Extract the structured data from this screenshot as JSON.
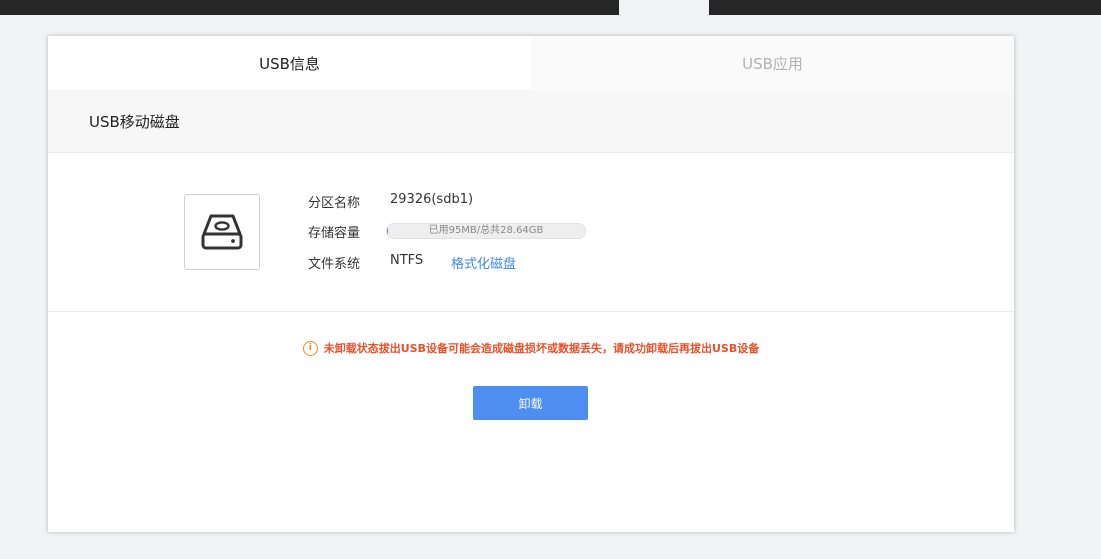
{
  "tabs": [
    {
      "label": "USB信息",
      "active": true
    },
    {
      "label": "USB应用",
      "active": false
    }
  ],
  "section": {
    "title": "USB移动磁盘"
  },
  "disk": {
    "icon": "hard-drive-icon",
    "partition_label": "分区名称",
    "partition_value": "29326(sdb1)",
    "capacity_label": "存储容量",
    "capacity_text": "已用95MB/总共28.64GB",
    "capacity_used_fraction": 0.003,
    "fs_label": "文件系统",
    "fs_value": "NTFS",
    "format_link": "格式化磁盘"
  },
  "warning": {
    "icon": "info-icon",
    "text": "未卸载状态拔出USB设备可能会造成磁盘损坏或数据丢失，请成功卸载后再拔出USB设备"
  },
  "actions": {
    "unmount_label": "卸载"
  },
  "colors": {
    "accent": "#4d8ef0",
    "link": "#3c89e8",
    "warning": "#e8522b"
  }
}
